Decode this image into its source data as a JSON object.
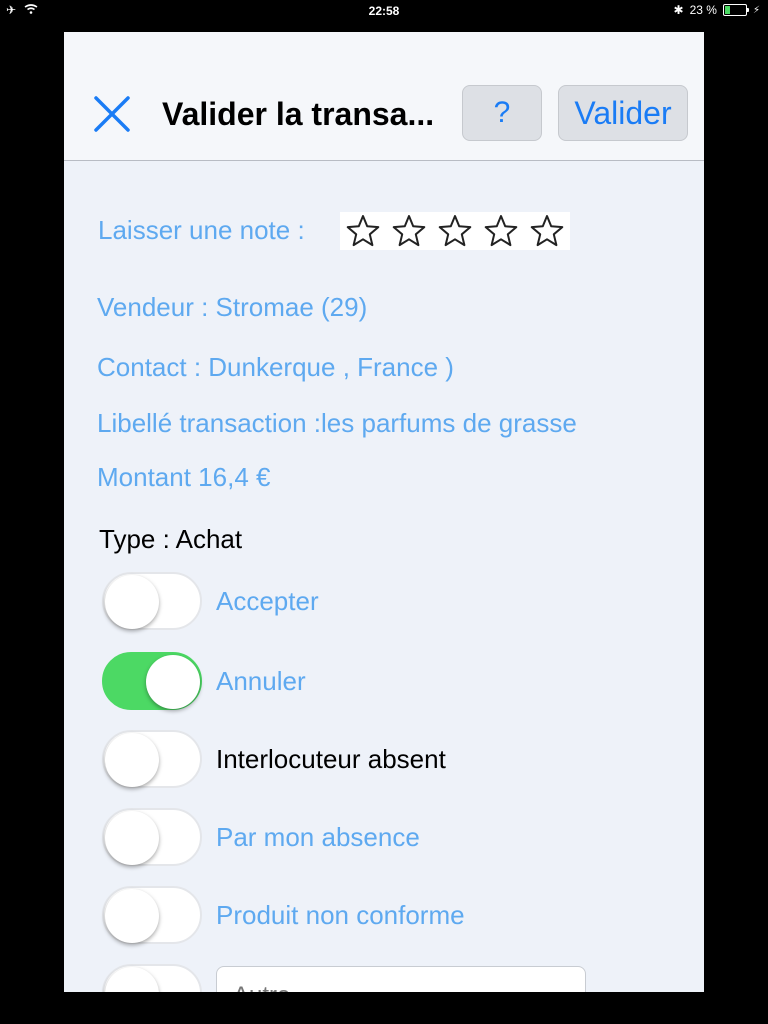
{
  "status_bar": {
    "time": "22:58",
    "battery_text": "23 %",
    "battery_level": 0.23
  },
  "nav": {
    "title": "Valider la transa...",
    "help_label": "?",
    "validate_label": "Valider"
  },
  "rating": {
    "label": "Laisser une note :",
    "stars_total": 5,
    "stars_filled": 0
  },
  "details": {
    "seller": "Vendeur : Stromae   (29)",
    "contact": "Contact : Dunkerque , France )",
    "label": "Libellé transaction :les parfums de grasse",
    "amount": "Montant 16,4 €"
  },
  "type_line": "Type : Achat",
  "options": [
    {
      "label": "Accepter",
      "on": false
    },
    {
      "label": "Annuler",
      "on": true
    },
    {
      "label": "Interlocuteur absent",
      "on": false
    },
    {
      "label": "Par mon absence",
      "on": false
    },
    {
      "label": "Produit non conforme",
      "on": false
    }
  ],
  "other_field": {
    "placeholder": "Autre"
  },
  "colors": {
    "accent": "#1a7cf5",
    "label_blue": "#5ea9f0",
    "toggle_on": "#4cd964",
    "sheet_bg": "#eef2f9"
  }
}
